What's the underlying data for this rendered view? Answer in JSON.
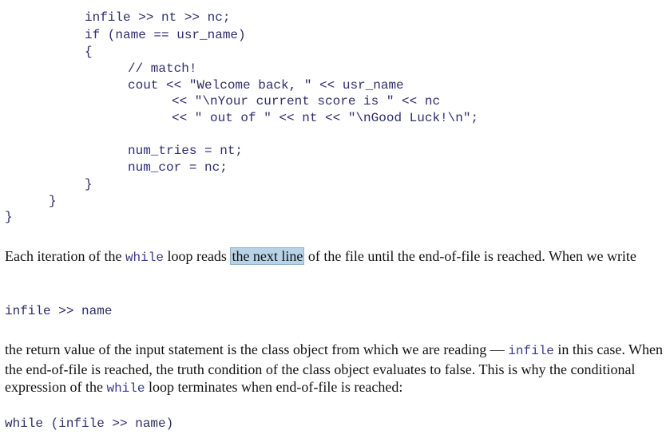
{
  "code_block": {
    "lines": [
      "infile >> nt >> nc;",
      "if (name == usr_name)",
      "{",
      "// match!",
      "cout << \"Welcome back, \" << usr_name",
      "<< \"\\nYour current score is \" << nc",
      "<< \" out of \" << nt << \"\\nGood Luck!\\n\";",
      "num_tries = nt;",
      "num_cor = nc;",
      "}",
      "}",
      "}"
    ]
  },
  "paragraph1": {
    "part1": "Each iteration of the ",
    "code1": "while",
    "part2": " loop reads ",
    "highlight": "the next line",
    "part3": " of the file until the end-of-file is reached. When we write"
  },
  "code_snippet1": "infile >> name",
  "paragraph2": {
    "part1": "the return value of the input statement is the class object from which we are reading — ",
    "code1": "infile",
    "part2": " in this case. When the end-of-file is reached, the truth condition of the class object evaluates to false. This is why the conditional expression of the ",
    "code2": "while",
    "part3": " loop terminates when end-of-file is reached:"
  },
  "code_snippet2": "while (infile >> name)"
}
